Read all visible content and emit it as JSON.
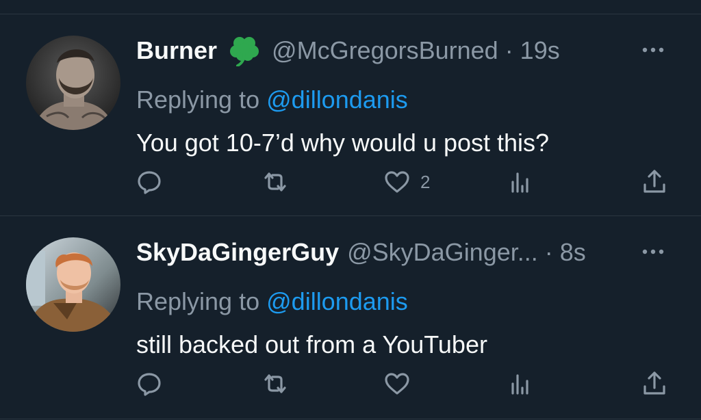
{
  "tweets": [
    {
      "display_name": "Burner",
      "emoji": "shamrock",
      "handle_time": "@McGregorsBurned · 19s",
      "replying_prefix": "Replying to",
      "replying_to": "@dillondanis",
      "text": "You got 10-7’d why would u post this?",
      "like_count": "2",
      "avatar": "avatar-photo-bearded-man",
      "icons": [
        "reply-icon",
        "retweet-icon",
        "like-icon",
        "views-icon",
        "share-icon",
        "more-icon"
      ]
    },
    {
      "display_name": "SkyDaGingerGuy",
      "handle_time": "@SkyDaGinger... · 8s",
      "replying_prefix": "Replying to",
      "replying_to": "@dillondanis",
      "text": "still backed out from a YouTuber",
      "like_count": "",
      "avatar": "avatar-photo-ginger-man",
      "icons": [
        "reply-icon",
        "retweet-icon",
        "like-icon",
        "views-icon",
        "share-icon",
        "more-icon"
      ]
    }
  ],
  "colors": {
    "background": "#15202b",
    "primary_text": "#f7f9f9",
    "secondary_text": "#8b98a5",
    "link": "#1d9bf0",
    "divider": "#2b3640",
    "clover": "#2fa84f"
  }
}
